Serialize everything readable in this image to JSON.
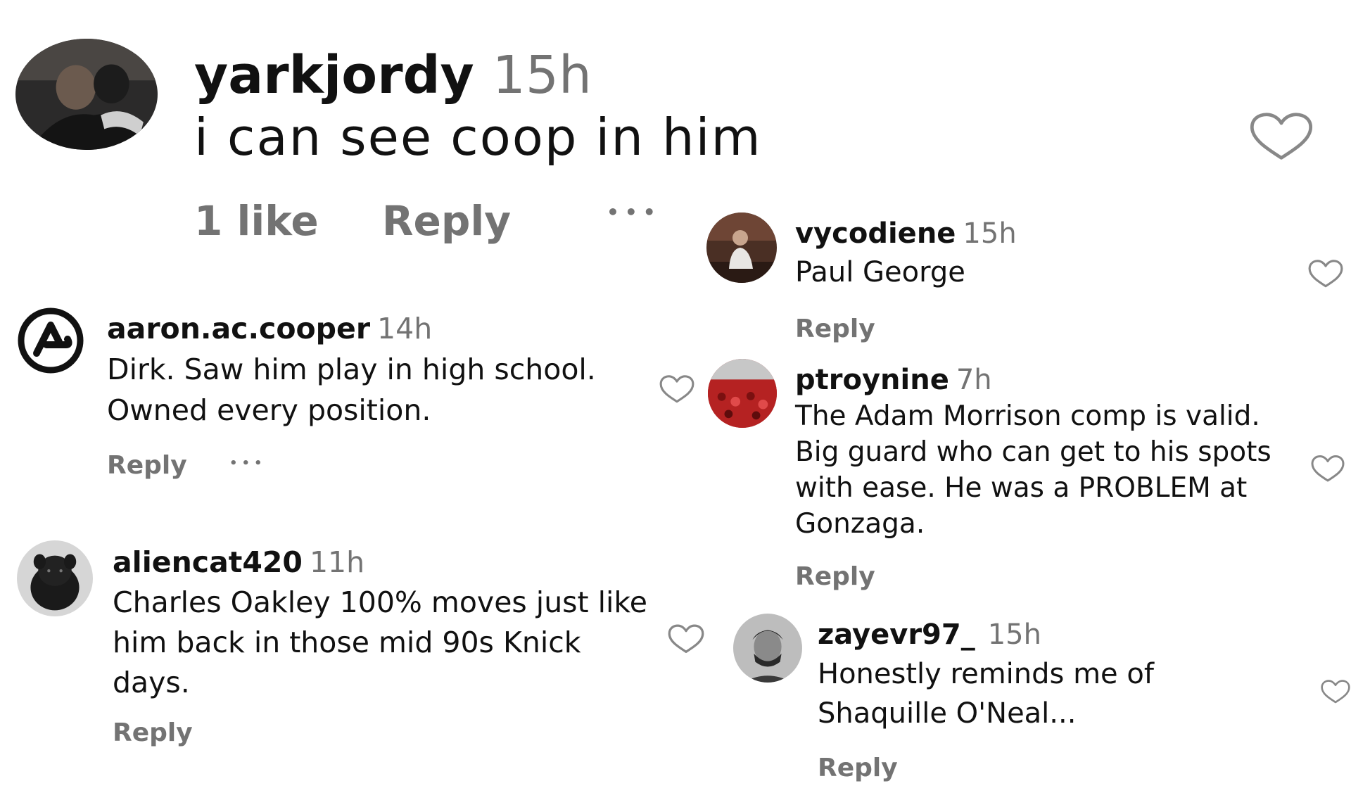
{
  "comments": {
    "yarkjordy": {
      "username": "yarkjordy",
      "time": "15h",
      "text": "i can see coop in him",
      "likes": "1 like",
      "reply": "Reply",
      "more": "•••"
    },
    "aaron": {
      "username": "aaron.ac.cooper",
      "time": "14h",
      "text": "Dirk. Saw him play in high school. Owned every position.",
      "reply": "Reply",
      "more": "•••"
    },
    "aliencat": {
      "username": "aliencat420",
      "time": "11h",
      "text": "Charles Oakley 100% moves just like him back in those mid 90s Knick days.",
      "reply": "Reply"
    },
    "vycodiene": {
      "username": "vycodiene",
      "time": "15h",
      "text": "Paul George",
      "reply": "Reply"
    },
    "ptroynine": {
      "username": "ptroynine",
      "time": "7h",
      "text": "The Adam Morrison comp is valid. Big guard who can get to his spots with ease. He was a PROBLEM at Gonzaga.",
      "reply": "Reply"
    },
    "zayevr": {
      "username": "zayevr97_",
      "time": "15h",
      "text": "Honestly reminds me of Shaquille O'Neal...",
      "reply": "Reply"
    }
  },
  "colors": {
    "text": "#111111",
    "muted": "#737373",
    "heart_outline": "#888888"
  },
  "icons": {
    "like": "heart-outline-icon",
    "more": "more-options-icon"
  }
}
